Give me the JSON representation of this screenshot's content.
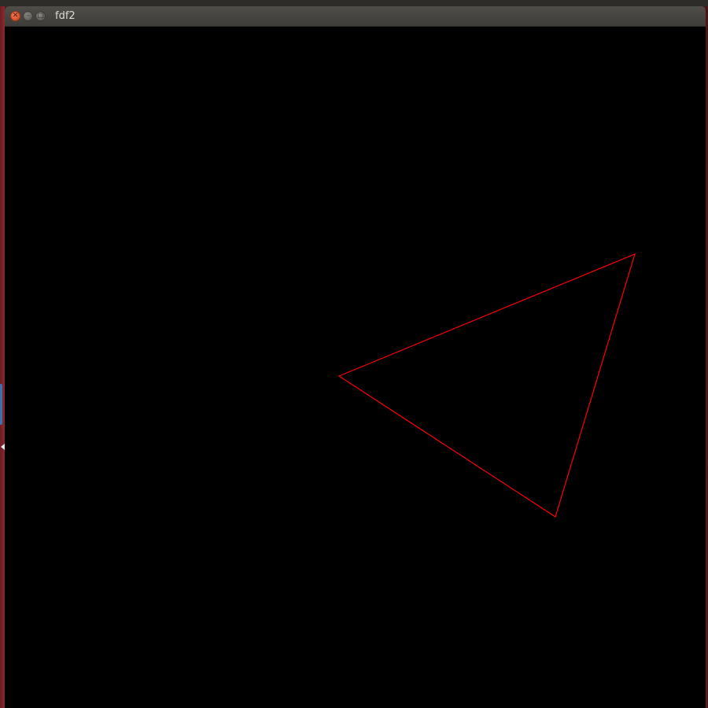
{
  "window": {
    "title": "fdf2",
    "controls": {
      "close_icon": "close-icon",
      "minimize_icon": "minimize-icon",
      "maximize_icon": "maximize-icon"
    }
  },
  "colors": {
    "canvas_background": "#000000",
    "shape_stroke": "#ff0000"
  }
}
